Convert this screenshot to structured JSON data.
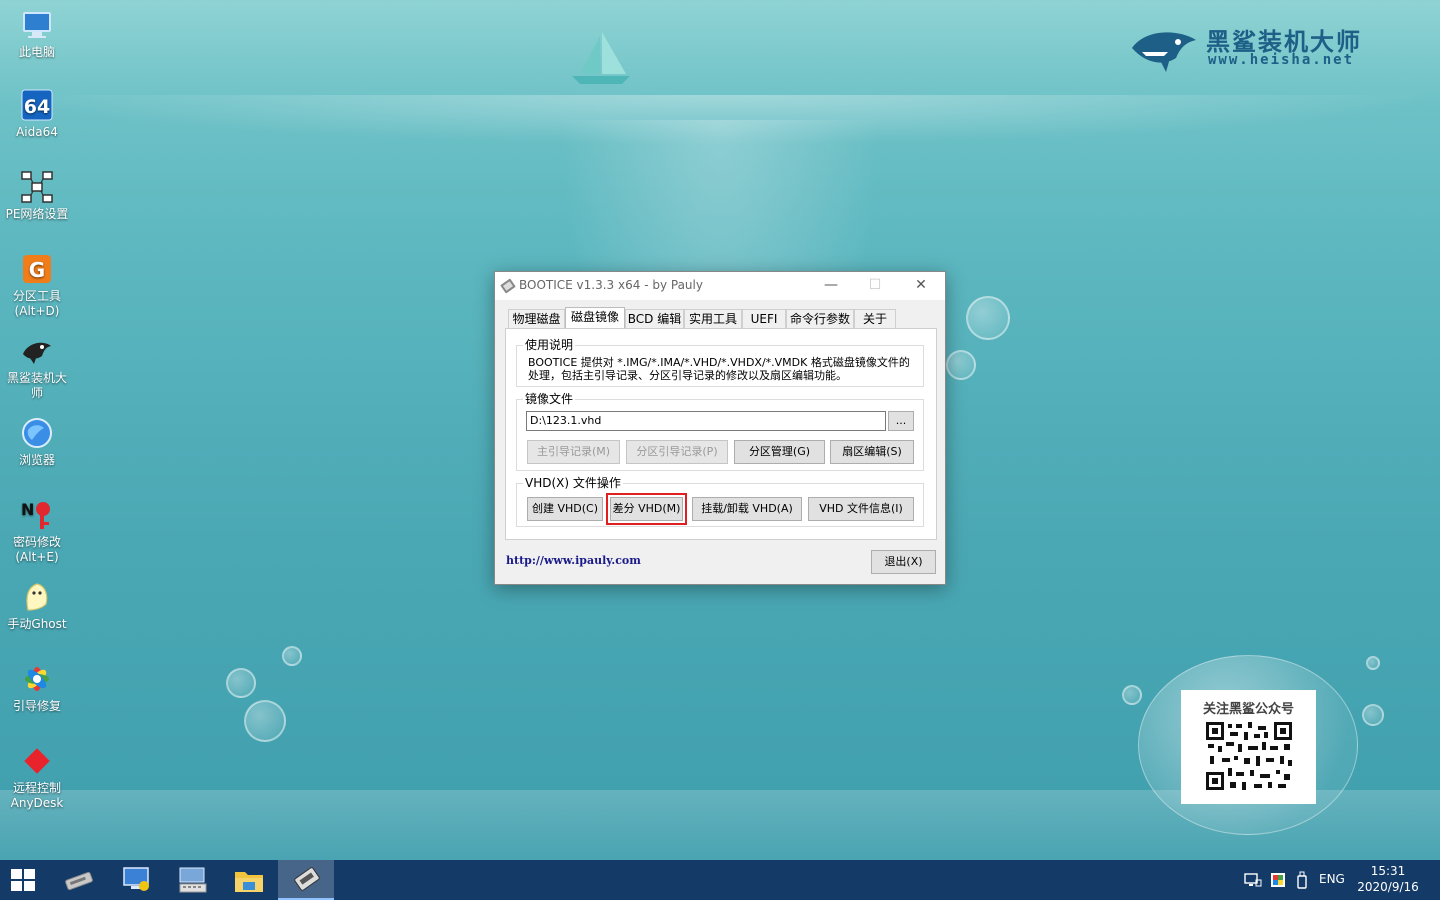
{
  "desktop": {
    "icons": [
      {
        "label": "此电脑",
        "icon": "computer-icon"
      },
      {
        "label": "Aida64",
        "icon": "aida64-icon"
      },
      {
        "label": "PE网络设置",
        "icon": "network-icon"
      },
      {
        "label": "分区工具",
        "sub": "(Alt+D)",
        "icon": "partition-tool-icon"
      },
      {
        "label": "黑鲨装机大",
        "sub": "师",
        "icon": "heisha-icon"
      },
      {
        "label": "浏览器",
        "icon": "browser-icon"
      },
      {
        "label": "密码修改",
        "sub": "(Alt+E)",
        "icon": "password-icon"
      },
      {
        "label": "手动Ghost",
        "icon": "ghost-icon"
      },
      {
        "label": "引导修复",
        "icon": "boot-repair-icon"
      },
      {
        "label": "远程控制",
        "sub": "AnyDesk",
        "icon": "anydesk-icon"
      }
    ],
    "logo": {
      "title": "黑鲨装机大师",
      "url": "www.heisha.net"
    },
    "qr": {
      "title": "关注黑鲨公众号"
    }
  },
  "window": {
    "title": "BOOTICE v1.3.3 x64 - by Pauly",
    "controls": {
      "minimize": "—",
      "maximize": "☐",
      "close": "✕"
    },
    "tabs": [
      {
        "label": "物理磁盘"
      },
      {
        "label": "磁盘镜像",
        "active": true
      },
      {
        "label": "BCD 编辑"
      },
      {
        "label": "实用工具"
      },
      {
        "label": "UEFI"
      },
      {
        "label": "命令行参数"
      },
      {
        "label": "关于"
      }
    ],
    "usage": {
      "label": "使用说明",
      "line1": "BOOTICE 提供对 *.IMG/*.IMA/*.VHD/*.VHDX/*.VMDK 格式磁盘镜像文件的",
      "line2": "处理，包括主引导记录、分区引导记录的修改以及扇区编辑功能。"
    },
    "image_file": {
      "label": "镜像文件",
      "path": "D:\\123.1.vhd",
      "browse": "...",
      "buttons": [
        "主引导记录(M)",
        "分区引导记录(P)",
        "分区管理(G)",
        "扇区编辑(S)"
      ]
    },
    "vhd_ops": {
      "label": "VHD(X) 文件操作",
      "buttons": [
        "创建 VHD(C)",
        "差分 VHD(M)",
        "挂载/卸载 VHD(A)",
        "VHD 文件信息(I)"
      ]
    },
    "link": "http://www.ipauly.com",
    "exit": "退出(X)"
  },
  "taskbar": {
    "lang": "ENG",
    "time": "15:31",
    "date": "2020/9/16"
  },
  "colors": {
    "taskbar": "#143a67",
    "highlight": "#e02020",
    "link": "#1a1a8a"
  }
}
